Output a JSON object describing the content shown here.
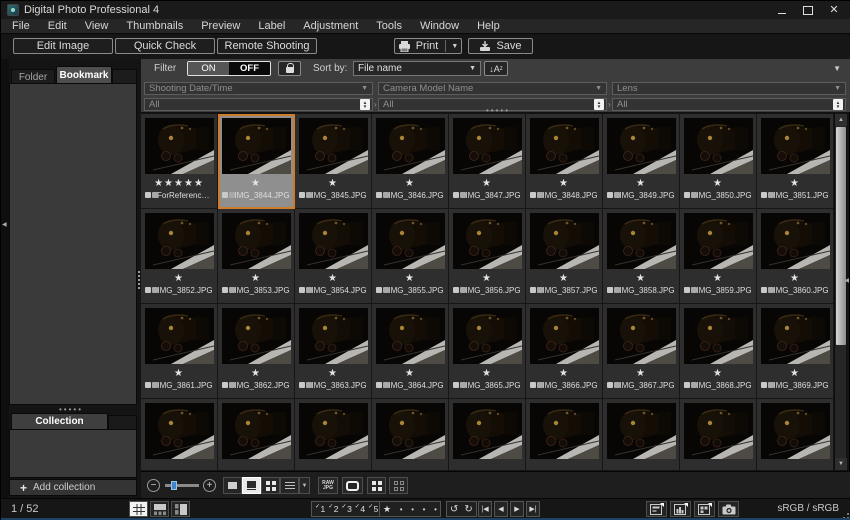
{
  "titlebar": {
    "title": "Digital Photo Professional 4"
  },
  "menu": [
    "File",
    "Edit",
    "View",
    "Thumbnails",
    "Preview",
    "Label",
    "Adjustment",
    "Tools",
    "Window",
    "Help"
  ],
  "toolbar": {
    "edit_image": "Edit Image",
    "quick_check": "Quick Check",
    "remote_shooting": "Remote Shooting",
    "print": "Print",
    "save": "Save"
  },
  "filter": {
    "label": "Filter",
    "on": "ON",
    "off": "OFF",
    "active_state": "OFF",
    "sort_by": "Sort by:",
    "sort_value": "File name",
    "fields": [
      {
        "placeholder": "Shooting Date/Time",
        "value": "All"
      },
      {
        "placeholder": "Camera Model Name",
        "value": "All"
      },
      {
        "placeholder": "Lens",
        "value": "All"
      }
    ]
  },
  "sidebar": {
    "tabs": [
      {
        "label": "Folder",
        "active": false
      },
      {
        "label": "Bookmark",
        "active": true
      }
    ],
    "collection_tab": "Collection",
    "add_collection": "Add collection"
  },
  "grid": {
    "images": [
      {
        "name": "ForReference_Foc...",
        "stars": 5
      },
      {
        "name": "IMG_3844.JPG",
        "stars": 1,
        "selected": true
      },
      {
        "name": "IMG_3845.JPG",
        "stars": 1
      },
      {
        "name": "IMG_3846.JPG",
        "stars": 1
      },
      {
        "name": "IMG_3847.JPG",
        "stars": 1
      },
      {
        "name": "IMG_3848.JPG",
        "stars": 1
      },
      {
        "name": "IMG_3849.JPG",
        "stars": 1
      },
      {
        "name": "IMG_3850.JPG",
        "stars": 1
      },
      {
        "name": "IMG_3851.JPG",
        "stars": 1
      },
      {
        "name": "IMG_3852.JPG",
        "stars": 1
      },
      {
        "name": "IMG_3853.JPG",
        "stars": 1
      },
      {
        "name": "IMG_3854.JPG",
        "stars": 1
      },
      {
        "name": "IMG_3855.JPG",
        "stars": 1
      },
      {
        "name": "IMG_3856.JPG",
        "stars": 1
      },
      {
        "name": "IMG_3857.JPG",
        "stars": 1
      },
      {
        "name": "IMG_3858.JPG",
        "stars": 1
      },
      {
        "name": "IMG_3859.JPG",
        "stars": 1
      },
      {
        "name": "IMG_3860.JPG",
        "stars": 1
      },
      {
        "name": "IMG_3861.JPG",
        "stars": 1
      },
      {
        "name": "IMG_3862.JPG",
        "stars": 1
      },
      {
        "name": "IMG_3863.JPG",
        "stars": 1
      },
      {
        "name": "IMG_3864.JPG",
        "stars": 1
      },
      {
        "name": "IMG_3865.JPG",
        "stars": 1
      },
      {
        "name": "IMG_3866.JPG",
        "stars": 1
      },
      {
        "name": "IMG_3867.JPG",
        "stars": 1
      },
      {
        "name": "IMG_3868.JPG",
        "stars": 1
      },
      {
        "name": "IMG_3869.JPG",
        "stars": 1
      },
      {
        "partial": true
      },
      {
        "partial": true
      },
      {
        "partial": true
      },
      {
        "partial": true
      },
      {
        "partial": true
      },
      {
        "partial": true
      },
      {
        "partial": true
      },
      {
        "partial": true
      },
      {
        "partial": true
      }
    ]
  },
  "grid_toolbar": {
    "raw_top": "RAW",
    "raw_bottom": "JPG"
  },
  "statusbar": {
    "position": "1 / 52",
    "check_labels": [
      "1",
      "2",
      "3",
      "4",
      "5"
    ],
    "rating": [
      "★",
      "•",
      "•",
      "•",
      "•"
    ],
    "color_space": "sRGB / sRGB"
  },
  "colors": {
    "selection_border": "#cf7c2a",
    "selection_bg": "#8f8f8f",
    "window_edge_blue": "#1d4266",
    "slider_handle_blue": "#3f85c9"
  }
}
